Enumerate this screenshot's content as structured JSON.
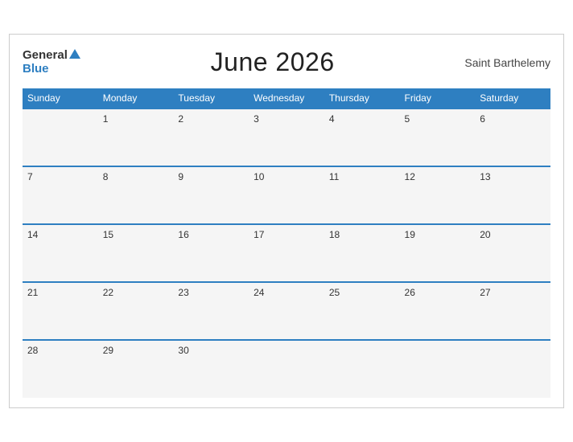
{
  "header": {
    "logo_general": "General",
    "logo_blue": "Blue",
    "title": "June 2026",
    "region": "Saint Barthelemy"
  },
  "weekdays": [
    "Sunday",
    "Monday",
    "Tuesday",
    "Wednesday",
    "Thursday",
    "Friday",
    "Saturday"
  ],
  "weeks": [
    [
      "",
      "1",
      "2",
      "3",
      "4",
      "5",
      "6"
    ],
    [
      "7",
      "8",
      "9",
      "10",
      "11",
      "12",
      "13"
    ],
    [
      "14",
      "15",
      "16",
      "17",
      "18",
      "19",
      "20"
    ],
    [
      "21",
      "22",
      "23",
      "24",
      "25",
      "26",
      "27"
    ],
    [
      "28",
      "29",
      "30",
      "",
      "",
      "",
      ""
    ]
  ]
}
